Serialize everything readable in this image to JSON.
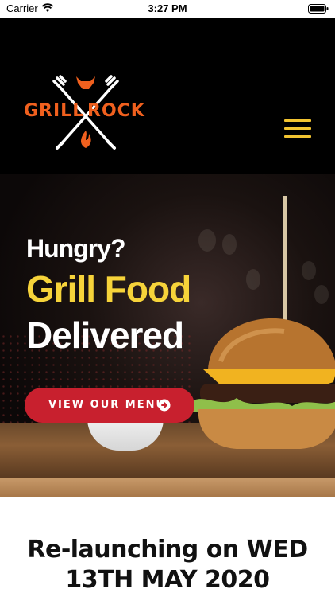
{
  "status_bar": {
    "carrier": "Carrier",
    "time": "3:27 PM"
  },
  "header": {
    "logo_left": "GRILL",
    "logo_right": "ROCK",
    "menu_icon": "hamburger-menu-icon",
    "accent_color": "#f0601e",
    "menu_color": "#f2c431"
  },
  "hero": {
    "line1": "Hungry?",
    "line2": "Grill Food",
    "line3": "Delivered",
    "cta_label": "VIEW OUR MENU",
    "cta_icon": "arrow-circle-right-icon",
    "cta_color": "#c8202e",
    "highlight_color": "#f6d33a"
  },
  "announcement": {
    "line1": "Re-launching on WED",
    "line2": "13TH MAY 2020"
  }
}
